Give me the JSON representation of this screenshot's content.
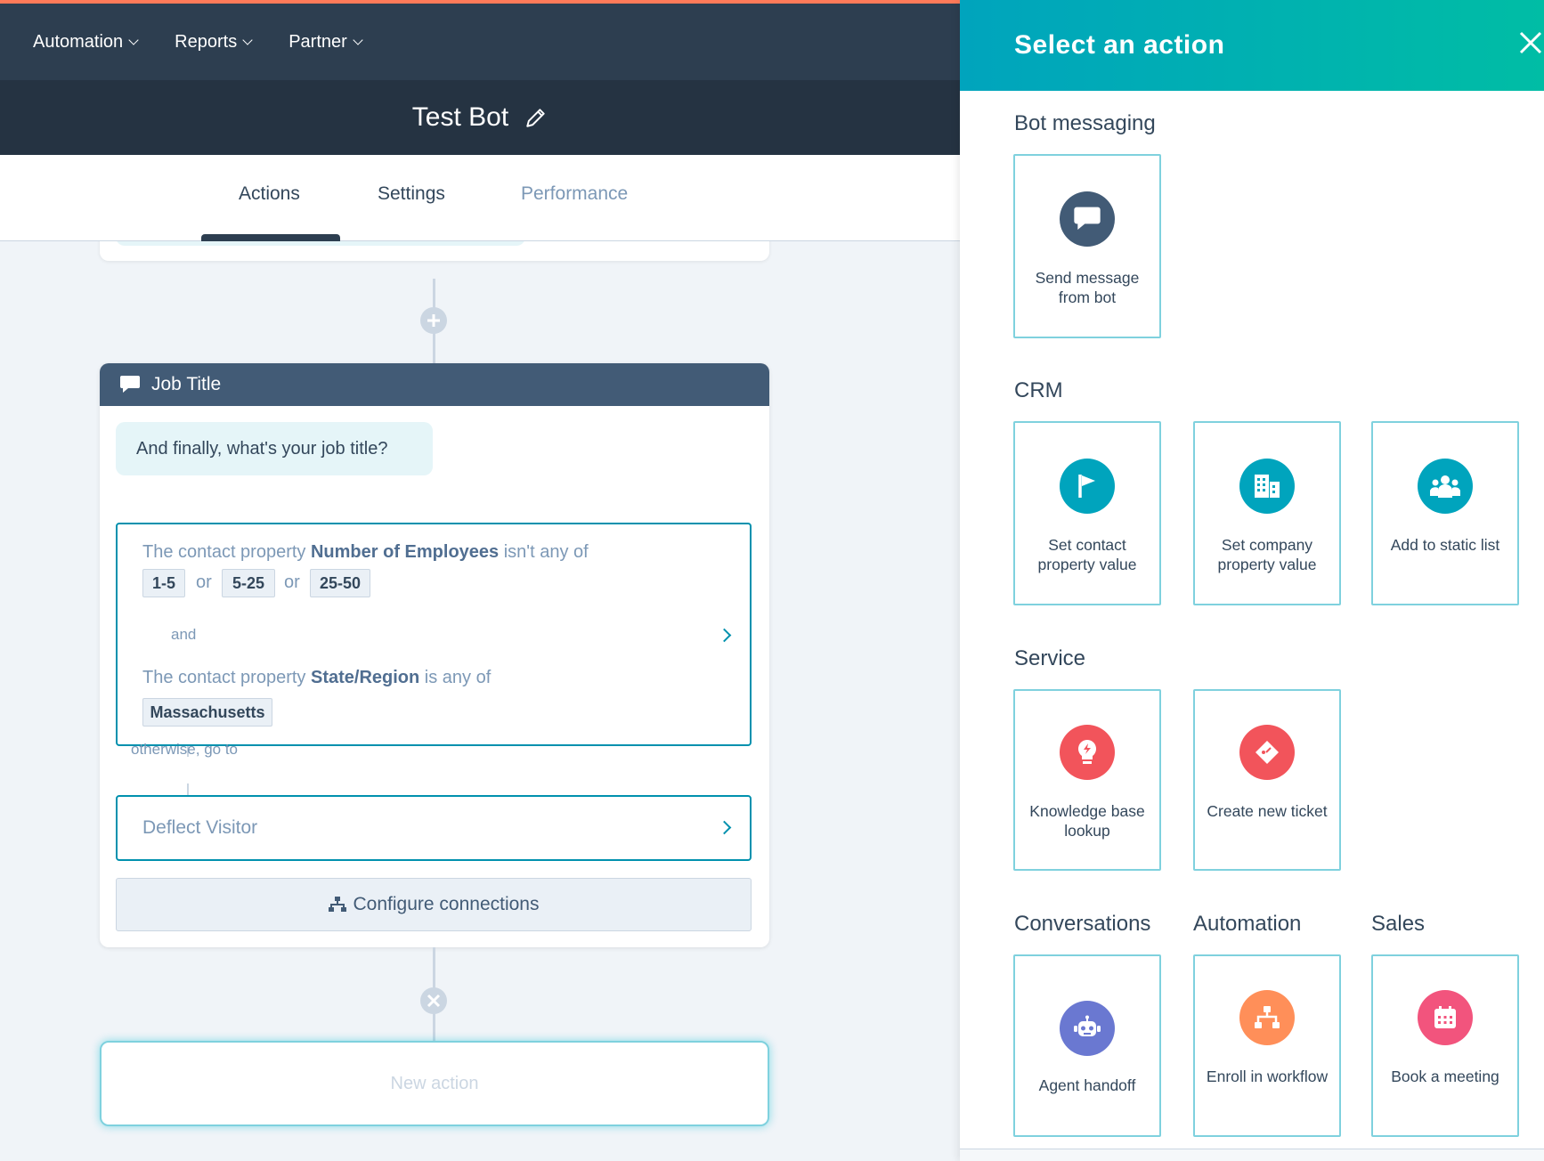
{
  "nav": {
    "items": [
      {
        "label": "Automation"
      },
      {
        "label": "Reports"
      },
      {
        "label": "Partner"
      }
    ]
  },
  "bot": {
    "title": "Test Bot",
    "edit_icon": "pencil-icon"
  },
  "tabs": [
    {
      "label": "Actions",
      "active": true
    },
    {
      "label": "Settings",
      "active": false
    },
    {
      "label": "Performance",
      "active": false
    }
  ],
  "card": {
    "header_icon": "chat-bubble-icon",
    "title": "Job Title",
    "message": "And finally, what's your job title?",
    "rule1": {
      "prefix": "The contact property ",
      "property": "Number of Employees",
      "operator": " isn't any of",
      "values": [
        "1-5",
        "5-25",
        "25-50"
      ],
      "joiner": "or"
    },
    "and_label": "and",
    "rule2": {
      "prefix": "The contact property ",
      "property": "State/Region",
      "operator": " is any of",
      "values": [
        "Massachusetts"
      ]
    },
    "otherwise_label": "otherwise, go to",
    "deflect_label": "Deflect Visitor",
    "configure_label": "Configure connections"
  },
  "new_action_label": "New action",
  "panel": {
    "title": "Select an action",
    "sections": [
      {
        "title": "Bot messaging",
        "tiles": [
          {
            "label": "Send message from bot",
            "icon": "chat-bubble-icon",
            "color": "#425b76"
          }
        ]
      },
      {
        "title": "CRM",
        "tiles": [
          {
            "label": "Set contact property value",
            "icon": "flag-icon",
            "color": "#00a4bd"
          },
          {
            "label": "Set company property value",
            "icon": "building-icon",
            "color": "#00a4bd"
          },
          {
            "label": "Add to static list",
            "icon": "people-icon",
            "color": "#00a4bd"
          }
        ]
      },
      {
        "title": "Service",
        "tiles": [
          {
            "label": "Knowledge base lookup",
            "icon": "lightbulb-icon",
            "color": "#f2545b"
          },
          {
            "label": "Create new ticket",
            "icon": "ticket-icon",
            "color": "#f2545b"
          }
        ]
      },
      {
        "title": "Conversations",
        "tiles": [
          {
            "label": "Agent handoff",
            "icon": "robot-icon",
            "color": "#6a78d1"
          }
        ]
      },
      {
        "title": "Automation",
        "tiles": [
          {
            "label": "Enroll in workflow",
            "icon": "workflow-icon",
            "color": "#ff8f59"
          }
        ]
      },
      {
        "title": "Sales",
        "tiles": [
          {
            "label": "Book a meeting",
            "icon": "calendar-icon",
            "color": "#f2547d"
          }
        ]
      }
    ]
  },
  "colors": {
    "nav_bg": "#2d3e50",
    "accent_teal": "#00a4bd",
    "accent_orange": "#ff7a59",
    "branch_border": "#0091ae"
  }
}
